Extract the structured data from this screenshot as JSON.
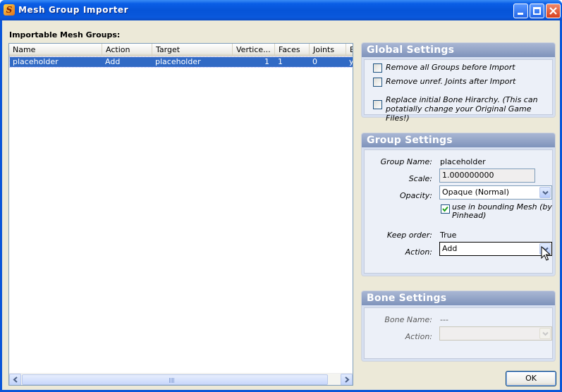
{
  "window": {
    "title": "Mesh Group Importer",
    "app_icon_letter": "S"
  },
  "list": {
    "label": "Importable Mesh Groups:",
    "columns": [
      "Name",
      "Action",
      "Target",
      "Vertice...",
      "Faces",
      "Joints",
      "B"
    ],
    "rows": [
      {
        "name": "placeholder",
        "action": "Add",
        "target": "placeholder",
        "vertices": "1",
        "faces": "1",
        "joints": "0",
        "b": "y"
      }
    ]
  },
  "global_settings": {
    "title": "Global Settings",
    "remove_groups": {
      "label": "Remove all Groups before Import",
      "checked": false
    },
    "remove_joints": {
      "label": "Remove unref. Joints after Import",
      "checked": false
    },
    "replace_bones": {
      "label_line1": "Replace initial Bone  Hirarchy. (This can",
      "label_line2": "potatially change your Original Game Files!)",
      "checked": false
    }
  },
  "group_settings": {
    "title": "Group Settings",
    "group_name_label": "Group Name:",
    "group_name_value": "placeholder",
    "scale_label": "Scale:",
    "scale_value": "1.000000000",
    "opacity_label": "Opacity:",
    "opacity_value": "Opaque (Normal)",
    "bounding_label_line1": "use in bounding Mesh (by",
    "bounding_label_line2": "Pinhead)",
    "bounding_checked": true,
    "keep_order_label": "Keep order:",
    "keep_order_value": "True",
    "action_label": "Action:",
    "action_value": "Add"
  },
  "bone_settings": {
    "title": "Bone Settings",
    "bone_name_label": "Bone Name:",
    "bone_name_value": "---",
    "action_label": "Action:",
    "action_value": ""
  },
  "ok_label": "OK",
  "colors": {
    "titlebar": "#0654d8",
    "selection": "#316ac5",
    "panel_header": "#8a9cc2"
  }
}
